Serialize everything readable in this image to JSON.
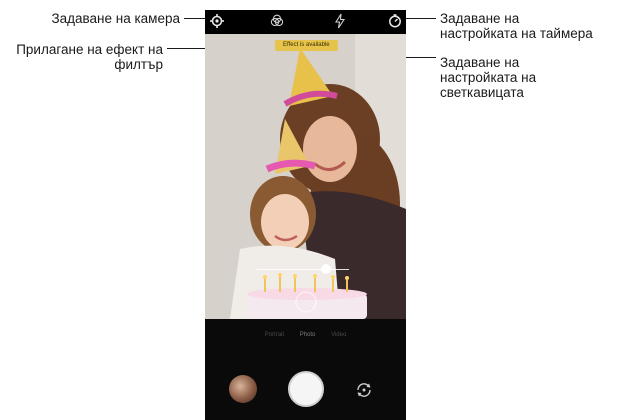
{
  "callouts": {
    "camera_settings": "Задаване на камера",
    "filter_effect_line1": "Прилагане на ефект на",
    "filter_effect_line2": "филтър",
    "timer_line1": "Задаване на",
    "timer_line2": "настройката на таймера",
    "flash_line1": "Задаване на",
    "flash_line2": "настройката на",
    "flash_line3": "светкавицата"
  },
  "topbar": {
    "icons": [
      "gear-icon",
      "filter-icon",
      "flash-icon",
      "timer-icon"
    ]
  },
  "viewfinder": {
    "filter_tag": "Effect is available"
  },
  "mode_bar": {
    "modes": [
      "Portrait",
      "Photo",
      "Video"
    ]
  },
  "bottom_controls": {
    "icons": [
      "gallery-thumbnail",
      "shutter-button",
      "switch-camera-icon"
    ]
  },
  "colors": {
    "background": "#ffffff",
    "phone_bg": "#0a0a0a",
    "tag_bg": "#e6c34a"
  }
}
